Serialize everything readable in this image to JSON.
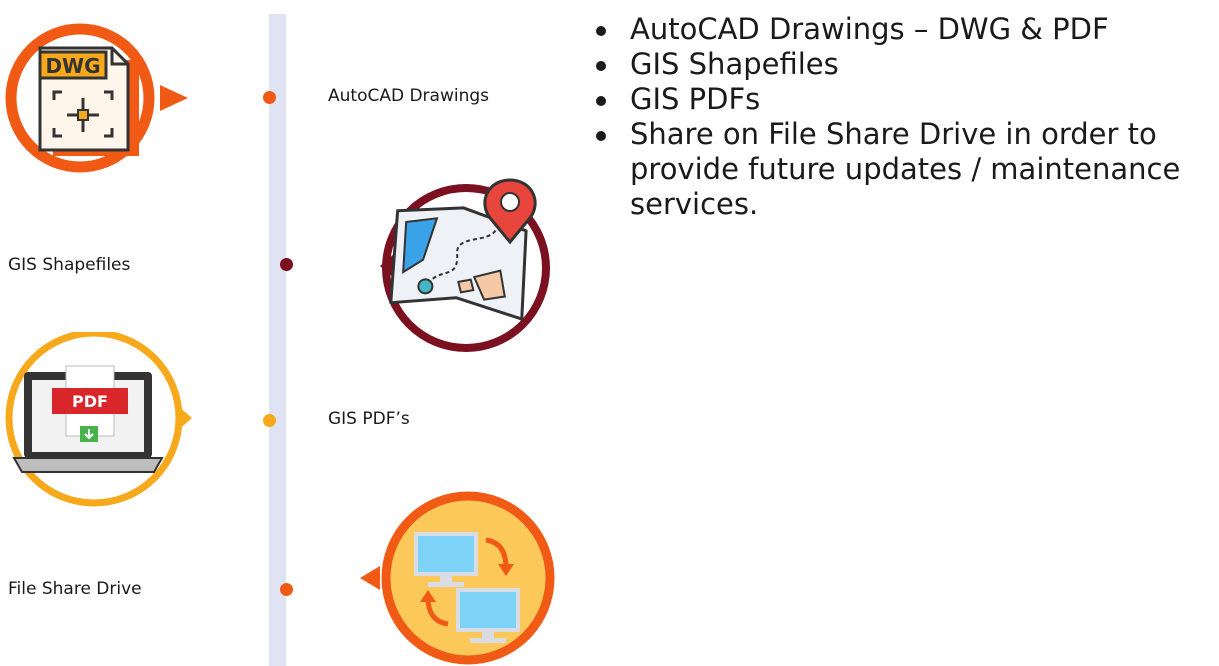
{
  "timeline": {
    "items": [
      {
        "label": "AutoCAD Drawings",
        "dot_color": "#f05a14"
      },
      {
        "label": "GIS Shapefiles",
        "dot_color": "#7a1020"
      },
      {
        "label": "GIS PDF’s",
        "dot_color": "#f7a81b"
      },
      {
        "label": "File Share Drive",
        "dot_color": "#f05a14"
      }
    ]
  },
  "icons": {
    "dwg": {
      "name": "dwg-file-icon",
      "ring_color": "#f05a14",
      "text": "DWG"
    },
    "map": {
      "name": "map-pin-icon",
      "ring_color": "#7a1020"
    },
    "pdf": {
      "name": "laptop-pdf-icon",
      "ring_color": "#f7a81b",
      "text": "PDF"
    },
    "share": {
      "name": "computer-sync-icon",
      "ring_color": "#f05a14"
    }
  },
  "bullets": [
    "AutoCAD Drawings – DWG & PDF",
    "GIS Shapefiles",
    "GIS PDFs",
    "Share on File Share Drive in order to provide future updates / maintenance services."
  ]
}
